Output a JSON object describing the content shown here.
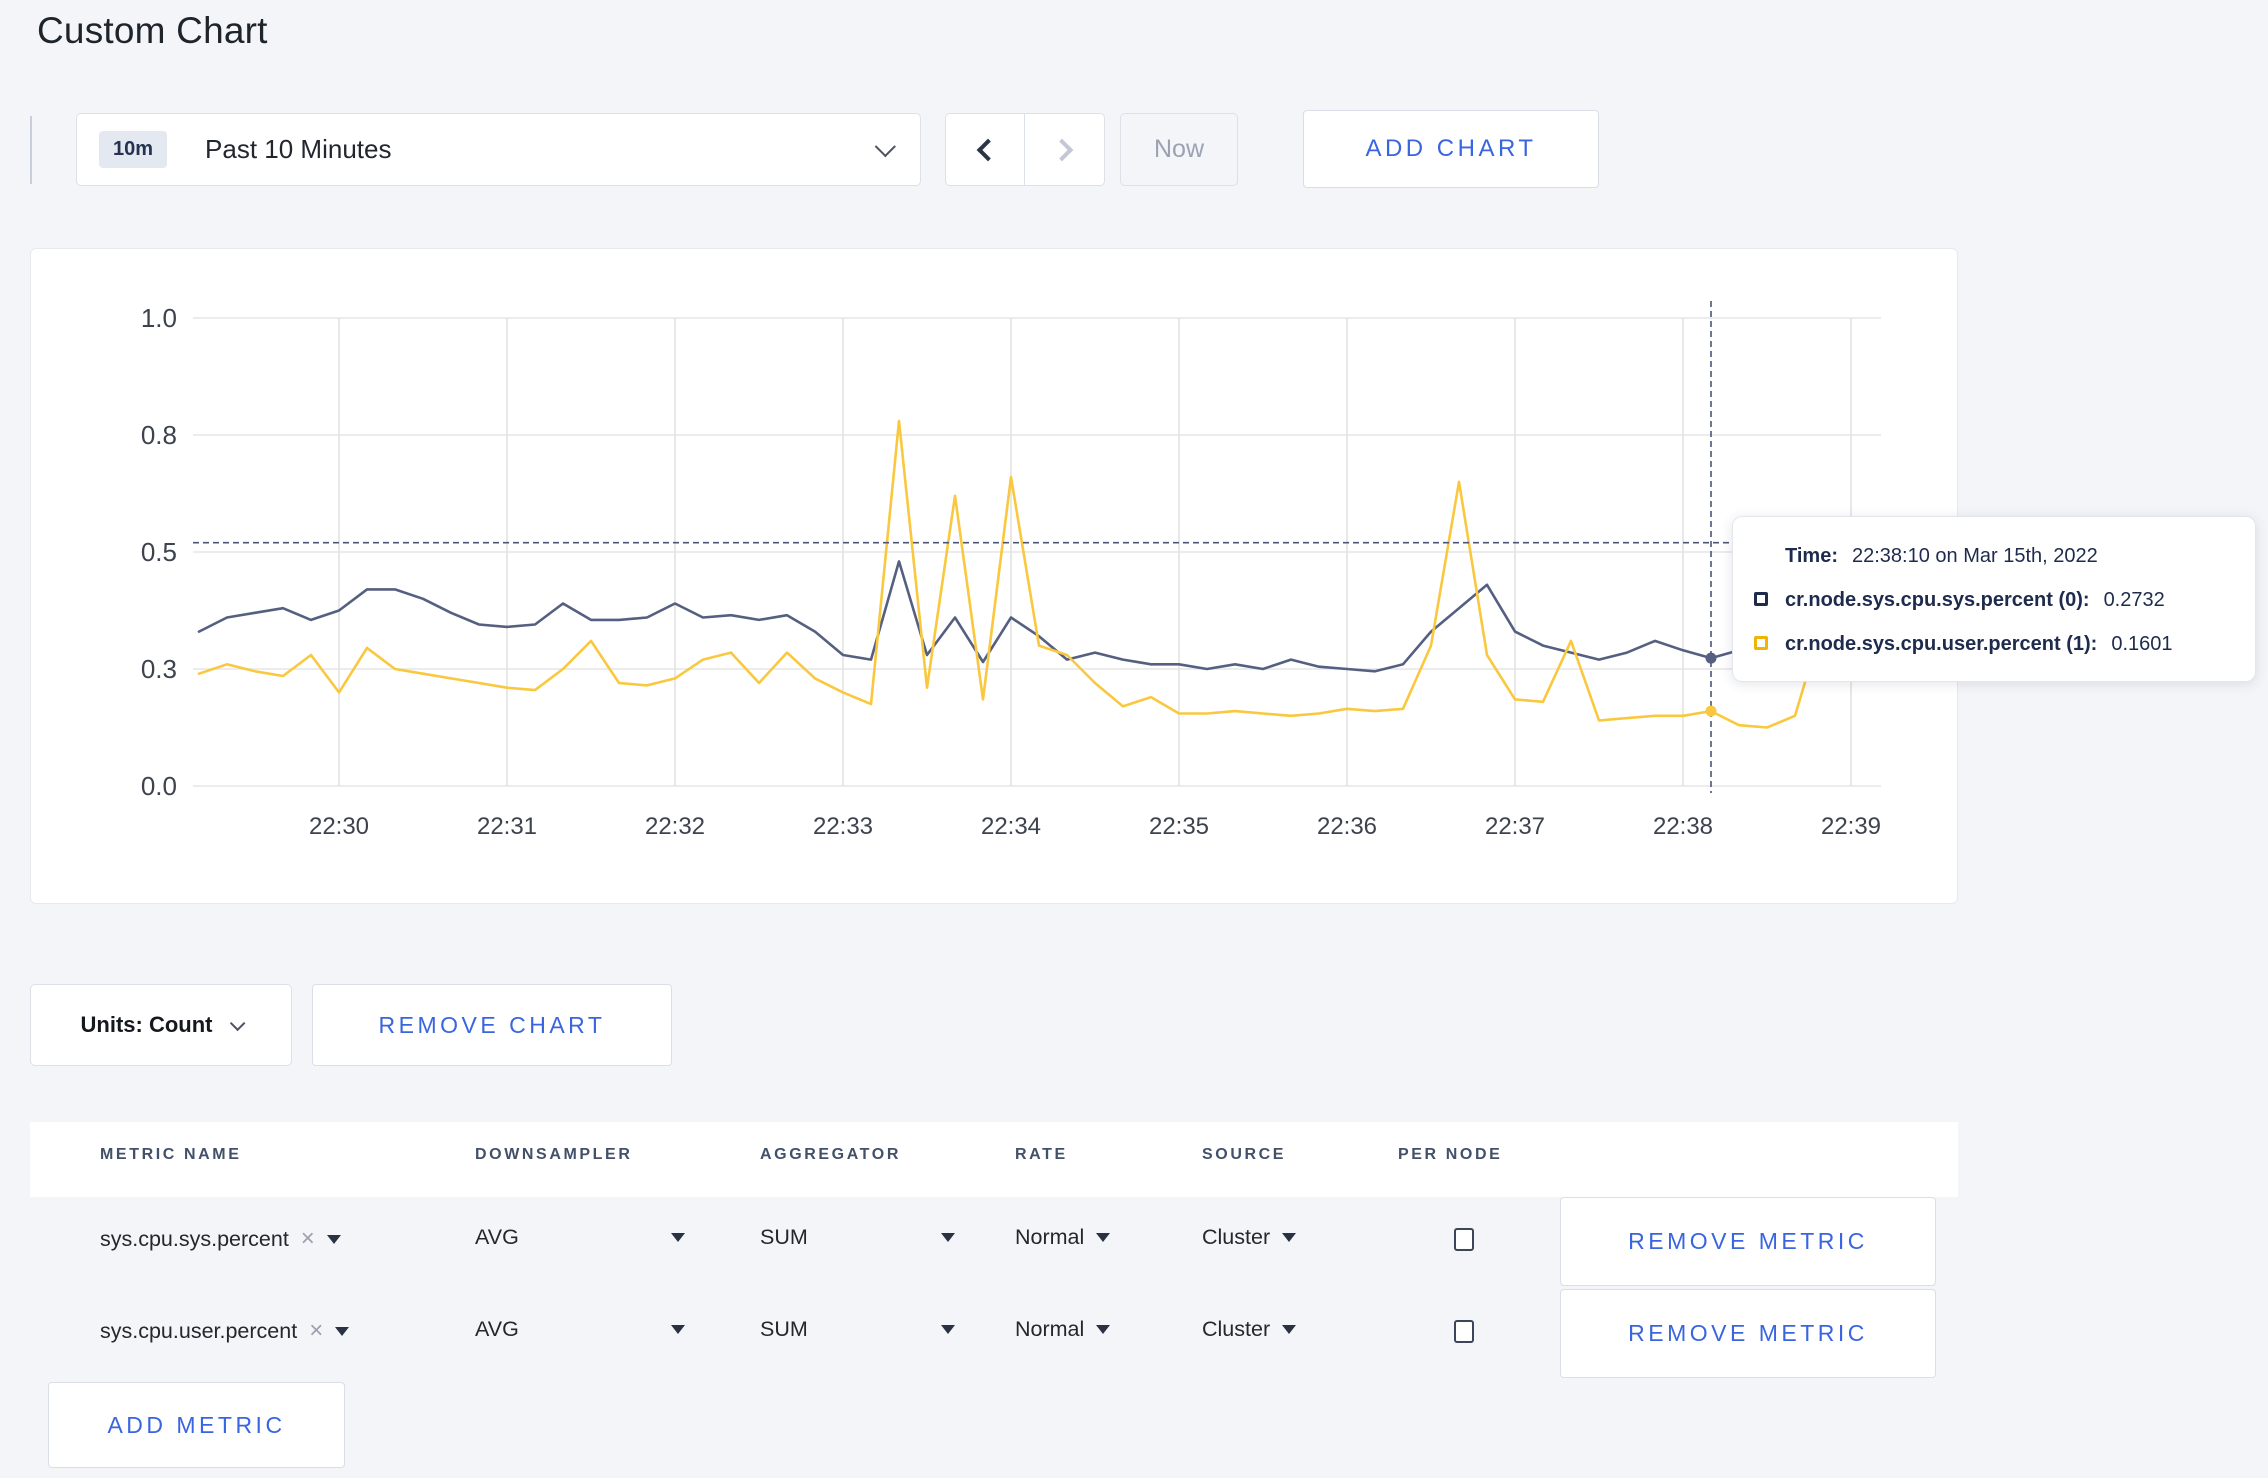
{
  "page": {
    "title": "Custom Chart"
  },
  "toolbar": {
    "time_badge": "10m",
    "time_label": "Past 10 Minutes",
    "now_label": "Now",
    "add_chart_label": "ADD CHART"
  },
  "chart_data": {
    "type": "line",
    "title": "",
    "xlabel": "",
    "ylabel": "",
    "ylim": [
      0.0,
      1.0
    ],
    "grid": true,
    "legend_position": "tooltip",
    "x_tick_labels": [
      "22:30",
      "22:31",
      "22:32",
      "22:33",
      "22:34",
      "22:35",
      "22:36",
      "22:37",
      "22:38",
      "22:39"
    ],
    "y_ticks": [
      0,
      0.25,
      0.5,
      0.75,
      1.0
    ],
    "y_tick_labels": [
      "0.0",
      "0.3",
      "0.5",
      "0.8",
      "1.0"
    ],
    "x_start_time": "22:29:10",
    "x_interval_seconds": 10,
    "series": [
      {
        "name": "cr.node.sys.cpu.sys.percent",
        "color": "#556080",
        "values": [
          0.33,
          0.36,
          0.37,
          0.38,
          0.355,
          0.375,
          0.42,
          0.42,
          0.4,
          0.37,
          0.345,
          0.34,
          0.345,
          0.39,
          0.355,
          0.355,
          0.36,
          0.39,
          0.36,
          0.365,
          0.355,
          0.365,
          0.33,
          0.28,
          0.27,
          0.48,
          0.28,
          0.36,
          0.265,
          0.36,
          0.32,
          0.27,
          0.285,
          0.27,
          0.26,
          0.26,
          0.25,
          0.26,
          0.25,
          0.27,
          0.255,
          0.25,
          0.245,
          0.26,
          0.33,
          0.38,
          0.43,
          0.33,
          0.3,
          0.285,
          0.27,
          0.285,
          0.31,
          0.29,
          0.2732,
          0.29,
          0.285,
          0.29,
          0.29,
          0.305,
          0.295
        ]
      },
      {
        "name": "cr.node.sys.cpu.user.percent",
        "color": "#f9c83e",
        "values": [
          0.24,
          0.26,
          0.245,
          0.235,
          0.28,
          0.2,
          0.295,
          0.25,
          0.24,
          0.23,
          0.22,
          0.21,
          0.205,
          0.25,
          0.31,
          0.22,
          0.215,
          0.23,
          0.27,
          0.285,
          0.22,
          0.285,
          0.23,
          0.2,
          0.175,
          0.78,
          0.21,
          0.62,
          0.185,
          0.66,
          0.3,
          0.28,
          0.22,
          0.17,
          0.19,
          0.155,
          0.155,
          0.16,
          0.155,
          0.15,
          0.155,
          0.165,
          0.16,
          0.165,
          0.3,
          0.65,
          0.28,
          0.185,
          0.18,
          0.31,
          0.14,
          0.145,
          0.15,
          0.15,
          0.1601,
          0.13,
          0.125,
          0.15,
          0.35,
          0.28,
          0.27
        ]
      }
    ],
    "crosshair": {
      "point_index": 54,
      "time": "22:38:10",
      "mouse_y_value": 0.52
    }
  },
  "tooltip": {
    "time_label": "Time:",
    "time_value": "22:38:10 on Mar 15th, 2022",
    "rows": [
      {
        "label": "cr.node.sys.cpu.sys.percent (0):",
        "value": "0.2732",
        "color": "#1e2b4d"
      },
      {
        "label": "cr.node.sys.cpu.user.percent (1):",
        "value": "0.1601",
        "color": "#f0b406"
      }
    ]
  },
  "units": {
    "label": "Units: Count"
  },
  "remove_chart_label": "REMOVE CHART",
  "metrics_table": {
    "columns": [
      "METRIC NAME",
      "DOWNSAMPLER",
      "AGGREGATOR",
      "RATE",
      "SOURCE",
      "PER NODE"
    ],
    "rows": [
      {
        "name": "sys.cpu.sys.percent",
        "downsampler": "AVG",
        "aggregator": "SUM",
        "rate": "Normal",
        "source": "Cluster",
        "per_node_checked": false,
        "remove_label": "REMOVE METRIC"
      },
      {
        "name": "sys.cpu.user.percent",
        "downsampler": "AVG",
        "aggregator": "SUM",
        "rate": "Normal",
        "source": "Cluster",
        "per_node_checked": false,
        "remove_label": "REMOVE METRIC"
      }
    ],
    "add_metric_label": "ADD METRIC"
  },
  "icons": {
    "remove_x": "×"
  }
}
